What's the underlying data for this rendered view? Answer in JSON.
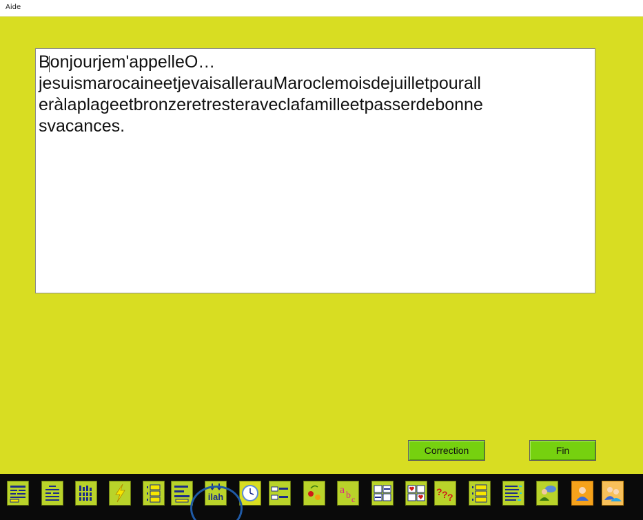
{
  "menubar": {
    "items": [
      {
        "label": "Aide"
      }
    ]
  },
  "editor": {
    "lines": [
      "Bonjourjem'appelleO…",
      "jesuismarocaineetjevaisallerauMaroclemoisdejuilletpourall",
      "eràlaplageetbronzeretresteraveclafamilleetpasserdebonne",
      "svacances."
    ]
  },
  "buttons": {
    "correction": "Correction",
    "fin": "Fin"
  },
  "toolbar": {
    "tools": [
      {
        "icon": "word-grid-icon"
      },
      {
        "icon": "word-blocks-icon"
      },
      {
        "icon": "letter-columns-icon"
      },
      {
        "icon": "lightning-icon"
      },
      {
        "icon": "numbered-list-icon"
      },
      {
        "icon": "word-lines-icon"
      },
      {
        "icon": "word-separate-icon",
        "label": "ilah"
      },
      {
        "icon": "clock-icon"
      },
      {
        "icon": "word-cards-icon"
      },
      {
        "icon": "cherries-icon"
      },
      {
        "icon": "abc-icon"
      },
      {
        "icon": "fill-grid-icon"
      },
      {
        "icon": "hearts-grid-icon"
      },
      {
        "icon": "question-marks-icon"
      },
      {
        "icon": "stacked-lines-icon"
      },
      {
        "icon": "letter-matrix-icon"
      },
      {
        "icon": "users-chat-icon"
      },
      {
        "icon": "single-user-icon"
      },
      {
        "icon": "multi-user-icon"
      }
    ],
    "colors": {
      "bar": "#0a0a0a",
      "tool": "#b9d32a",
      "user_tool": "#f6a21b",
      "highlight_ring": "#1f5aa6"
    }
  },
  "colors": {
    "background": "#d8dd22",
    "button": "#76d10f"
  }
}
